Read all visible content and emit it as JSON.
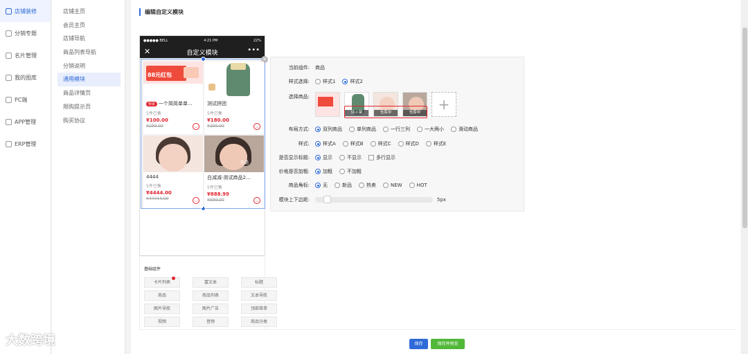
{
  "nav1": {
    "items": [
      {
        "label": "店铺装修",
        "active": true
      },
      {
        "label": "分销专题",
        "active": false
      },
      {
        "label": "名片管理",
        "active": false
      },
      {
        "label": "我的图库",
        "active": false
      },
      {
        "label": "PC端",
        "active": false
      },
      {
        "label": "APP管理",
        "active": false
      },
      {
        "label": "ERP管理",
        "active": false
      }
    ]
  },
  "nav2": {
    "items": [
      {
        "label": "店铺主页"
      },
      {
        "label": "会员主页"
      },
      {
        "label": "店铺导航"
      },
      {
        "label": "商品列表导航"
      },
      {
        "label": "分销说明"
      },
      {
        "label": "通用模块"
      },
      {
        "label": "商品详情页"
      },
      {
        "label": "限购提示页"
      },
      {
        "label": "购买协议"
      }
    ]
  },
  "page": {
    "title": "编辑自定义模块"
  },
  "phone": {
    "status_left": "●●●●● BELL",
    "status_time": "4:21 PM",
    "status_right": "22%",
    "title": "自定义模块",
    "products": [
      {
        "name": "一个简简单单...",
        "tag": "秒杀",
        "sold": "5件已售",
        "price": "¥100.00",
        "orig": "¥199.00",
        "banner": "88元红包"
      },
      {
        "name": "测试拼团",
        "tag": "",
        "sold": "5件已售",
        "price": "¥180.00",
        "orig": "¥399.00"
      },
      {
        "name": "4444",
        "tag": "",
        "sold": "5件已售",
        "price": "¥4444.00",
        "orig": "¥44444.00"
      },
      {
        "name": "白减减-测试商品2...",
        "tag": "",
        "sold": "5件已售",
        "price": "¥888.99",
        "orig": "¥999.00",
        "overlay": "无语"
      }
    ]
  },
  "components": {
    "title": "基础组件",
    "buttons": [
      "卡片列表",
      "富文本",
      "标题",
      "商品",
      "商品列表",
      "文本导航",
      "图片导航",
      "图片广告",
      "顶部菜单",
      "视频",
      "音频",
      "商品分类"
    ]
  },
  "editor": {
    "current_label": "当前组件:",
    "current_value": "商品",
    "style_label": "样式选择:",
    "style_options": [
      "样式1",
      "样式2"
    ],
    "select_label": "选择商品:",
    "thumb_status": [
      "待上架",
      "仓库中",
      "仓库中"
    ],
    "layout_label": "布局方式:",
    "layout_options": [
      "双列商品",
      "单列商品",
      "一行三列",
      "一大两小",
      "滑动商品"
    ],
    "variant_label": "样式:",
    "variant_options": [
      "样式A",
      "样式B",
      "样式C",
      "样式D",
      "样式E"
    ],
    "show_title_label": "是否显示标题:",
    "show_title_options": [
      "显示",
      "不显示"
    ],
    "multiline_label": "多行显示",
    "bold_label": "价格是否加粗:",
    "bold_options": [
      "加粗",
      "不加粗"
    ],
    "corner_label": "商品角标:",
    "corner_options": [
      "无",
      "新品",
      "热卖",
      "NEW",
      "HOT"
    ],
    "margin_label": "模块上下边距:",
    "margin_value": "5px"
  },
  "footer": {
    "save": "保存",
    "save_preview": "保存并预览"
  },
  "watermark": "大数跨境",
  "colors": {
    "accent": "#2f6bd8",
    "price": "#e0242e",
    "save": "#2f6bd8",
    "save_preview": "#52b83a"
  }
}
